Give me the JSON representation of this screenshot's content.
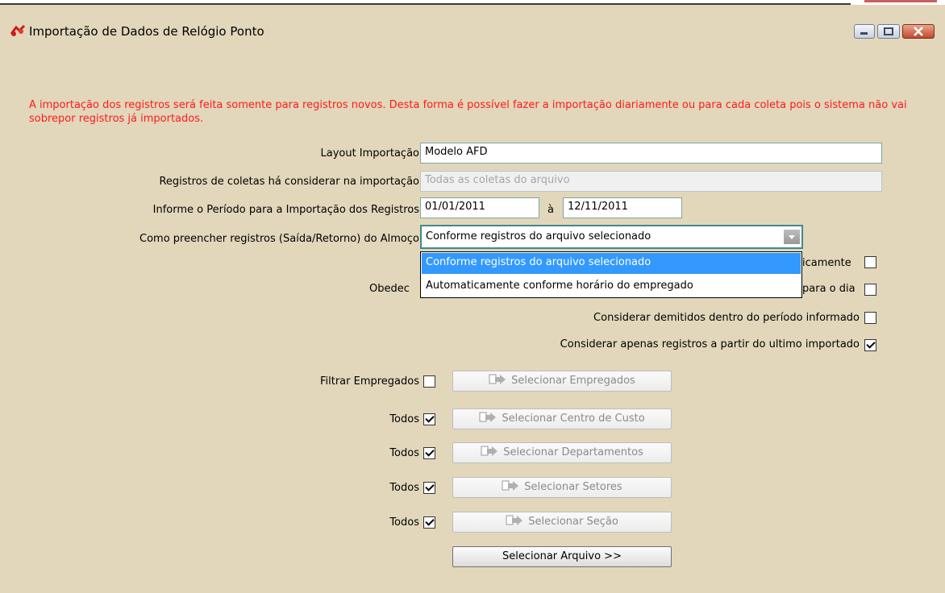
{
  "window": {
    "title": "Importação de Dados de Relógio Ponto"
  },
  "info_text": "A importação dos registros será feita somente para registros novos. Desta forma é possível fazer a importação diariamente ou para cada coleta pois o sistema não vai sobrepor registros já importados.",
  "form": {
    "layout_label": "Layout Importação",
    "layout_value": "Modelo AFD",
    "coletas_label": "Registros de coletas há considerar na importação",
    "coletas_value": "Todas as coletas do arquivo",
    "periodo_label": "Informe o Período para a Importação dos Registros",
    "periodo_start": "01/01/2011",
    "periodo_sep": "à",
    "periodo_end": "12/11/2011",
    "almoco_label": "Como preencher registros (Saída/Retorno) do Almoço",
    "almoco_value": "Conforme registros do arquivo selecionado"
  },
  "dropdown": {
    "options": [
      "Conforme registros do arquivo selecionado",
      "Automaticamente conforme horário do empregado"
    ],
    "selected_index": 0
  },
  "checkboxes": {
    "partial_1": "icamente",
    "partial_2_left": "Obedec",
    "partial_2_right": "para o dia",
    "demitidos": "Considerar demitidos dentro do período informado",
    "ultimo_importado": "Considerar apenas registros a partir do ultimo importado"
  },
  "checkbox_states": {
    "partial_1": false,
    "partial_2": false,
    "demitidos": false,
    "ultimo_importado": true,
    "filtrar_empregados": false,
    "todos_centro": true,
    "todos_departamentos": true,
    "todos_setores": true,
    "todos_secao": true
  },
  "filters": {
    "filtrar_label": "Filtrar Empregados",
    "todos_label": "Todos",
    "btn_empregados": "Selecionar Empregados",
    "btn_centro": "Selecionar Centro de Custo",
    "btn_departamentos": "Selecionar Departamentos",
    "btn_setores": "Selecionar Setores",
    "btn_secao": "Selecionar Seção",
    "btn_arquivo": "Selecionar Arquivo >>"
  },
  "colors": {
    "background": "#e2d7bb",
    "info_text": "#ff1a1a",
    "selection": "#3399ff"
  },
  "icons": [
    "app-clock-icon",
    "minimize-icon",
    "maximize-icon",
    "close-icon",
    "arrow-right-icon"
  ]
}
